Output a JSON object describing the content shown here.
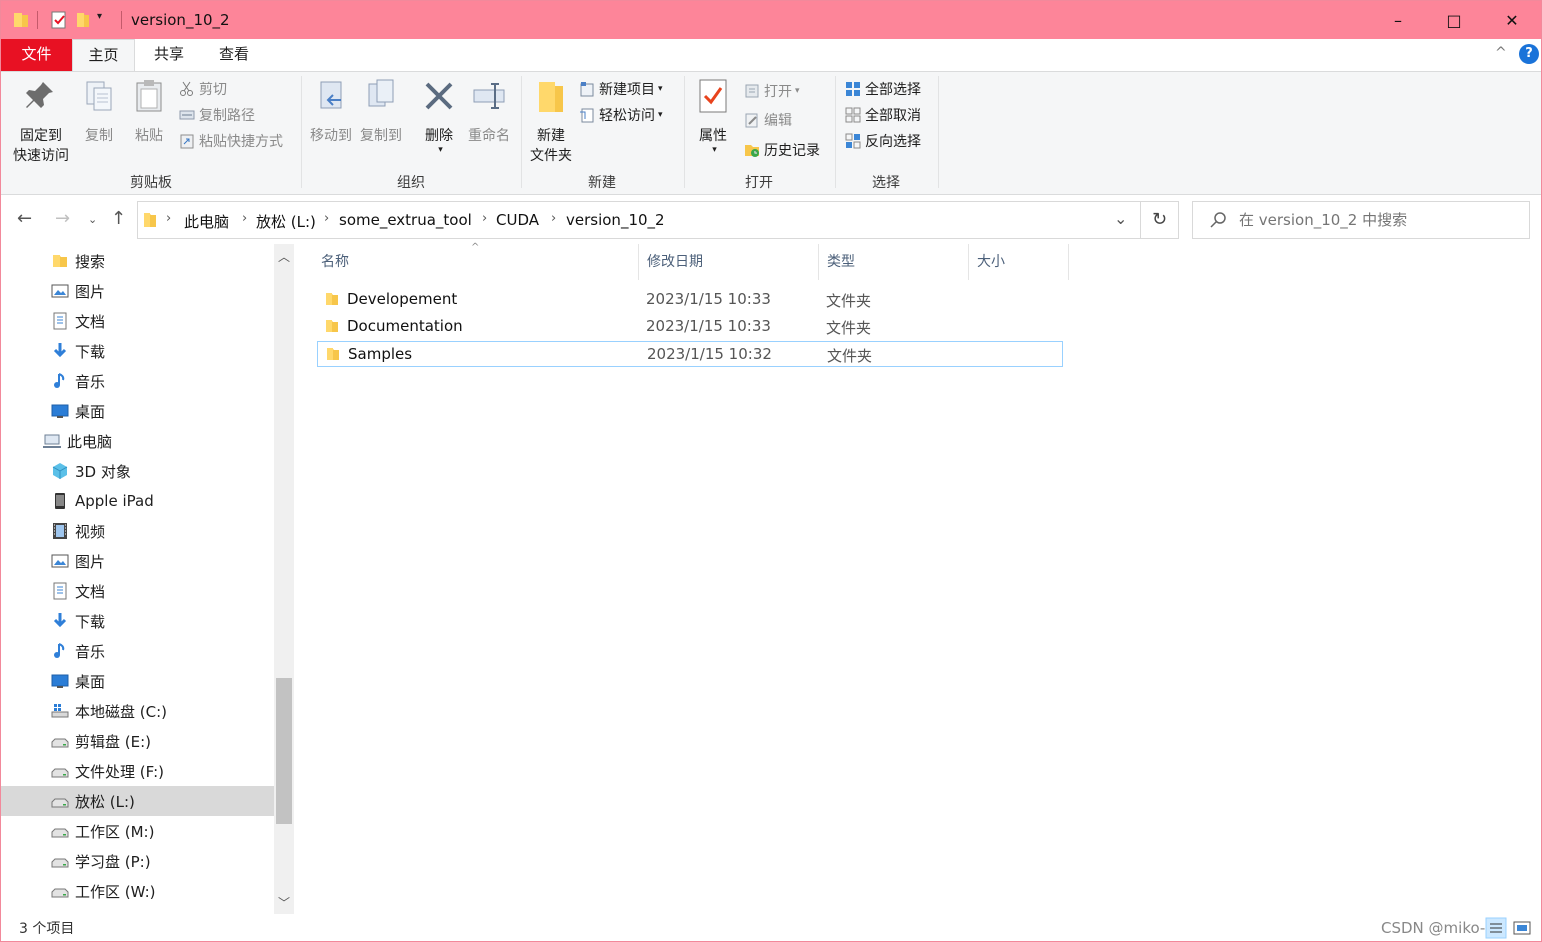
{
  "titlebar": {
    "title": "version_10_2",
    "minimize": "–",
    "maximize": "□",
    "close": "✕"
  },
  "tabs": {
    "file": "文件",
    "home": "主页",
    "share": "共享",
    "view": "查看",
    "collapse": "^",
    "help": "?"
  },
  "ribbon": {
    "clipboard": {
      "label": "剪贴板",
      "pin": [
        "固定到",
        "快速访问"
      ],
      "copy": "复制",
      "paste": "粘贴",
      "cut": "剪切",
      "copy_path": "复制路径",
      "paste_shortcut": "粘贴快捷方式"
    },
    "organize": {
      "label": "组织",
      "move_to": "移动到",
      "copy_to": "复制到",
      "delete": "删除",
      "rename": "重命名"
    },
    "new": {
      "label": "新建",
      "new_folder": [
        "新建",
        "文件夹"
      ],
      "new_item": "新建项目",
      "easy_access": "轻松访问"
    },
    "open": {
      "label": "打开",
      "properties": "属性",
      "open": "打开",
      "edit": "编辑",
      "history": "历史记录"
    },
    "select": {
      "label": "选择",
      "select_all": "全部选择",
      "select_none": "全部取消",
      "invert": "反向选择"
    }
  },
  "address": {
    "crumbs": [
      "此电脑",
      "放松 (L:)",
      "some_extrua_tool",
      "CUDA",
      "version_10_2"
    ],
    "search_placeholder": "在 version_10_2 中搜索"
  },
  "nav": {
    "items": [
      {
        "label": "搜索",
        "icon": "folder-icon"
      },
      {
        "label": "图片",
        "icon": "pictures-icon"
      },
      {
        "label": "文档",
        "icon": "documents-icon"
      },
      {
        "label": "下载",
        "icon": "download-icon"
      },
      {
        "label": "音乐",
        "icon": "music-icon"
      },
      {
        "label": "桌面",
        "icon": "desktop-icon"
      },
      {
        "label": "此电脑",
        "icon": "this-pc-icon"
      },
      {
        "label": "3D 对象",
        "icon": "3d-objects-icon"
      },
      {
        "label": "Apple iPad",
        "icon": "ipad-icon"
      },
      {
        "label": "视频",
        "icon": "videos-icon"
      },
      {
        "label": "图片",
        "icon": "pictures-icon"
      },
      {
        "label": "文档",
        "icon": "documents-icon"
      },
      {
        "label": "下载",
        "icon": "download-icon"
      },
      {
        "label": "音乐",
        "icon": "music-icon"
      },
      {
        "label": "桌面",
        "icon": "desktop-icon"
      },
      {
        "label": "本地磁盘 (C:)",
        "icon": "system-drive-icon"
      },
      {
        "label": "剪辑盘 (E:)",
        "icon": "drive-icon"
      },
      {
        "label": "文件处理 (F:)",
        "icon": "drive-icon"
      },
      {
        "label": "放松 (L:)",
        "icon": "drive-icon"
      },
      {
        "label": "工作区 (M:)",
        "icon": "drive-icon"
      },
      {
        "label": "学习盘 (P:)",
        "icon": "drive-icon"
      },
      {
        "label": "工作区 (W:)",
        "icon": "drive-icon"
      }
    ]
  },
  "content": {
    "columns": [
      "名称",
      "修改日期",
      "类型",
      "大小"
    ],
    "rows": [
      {
        "name": "Developement",
        "date": "2023/1/15 10:33",
        "type": "文件夹"
      },
      {
        "name": "Documentation",
        "date": "2023/1/15 10:33",
        "type": "文件夹"
      },
      {
        "name": "Samples",
        "date": "2023/1/15 10:32",
        "type": "文件夹"
      }
    ]
  },
  "status": {
    "count": "3 个项目",
    "watermark": "CSDN @miko-晨"
  },
  "colors": {
    "titlebar": "#fd8599",
    "file_tab": "#e81123",
    "folder": "#ffc83d",
    "selection_border": "#99d1ff"
  }
}
